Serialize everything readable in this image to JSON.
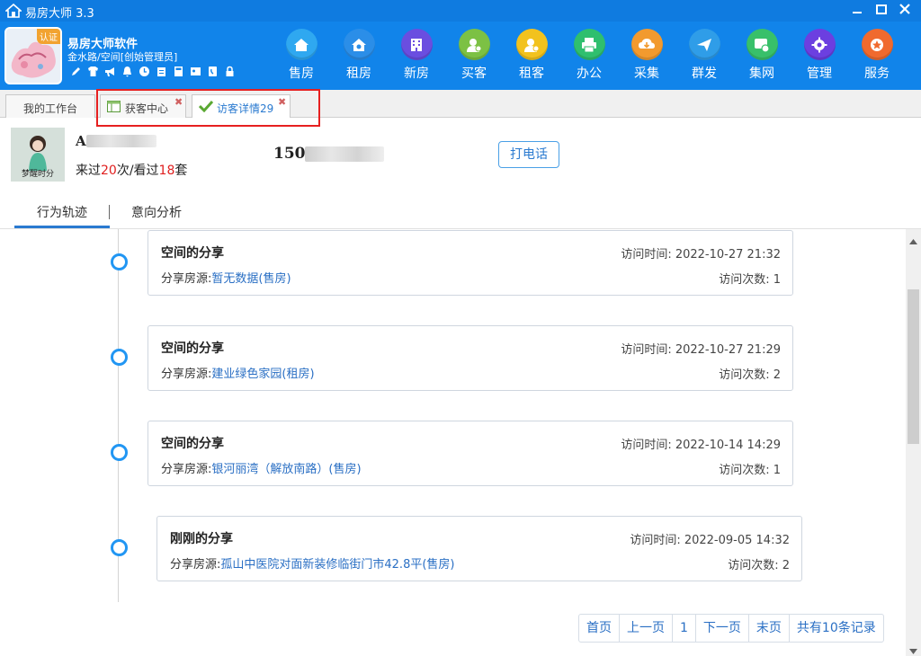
{
  "window": {
    "title": "易房大师 3.3"
  },
  "header": {
    "badge": "认证",
    "company": "易房大师软件",
    "subtitle": "金水路/空间[创始管理员]",
    "nav": [
      {
        "label": "售房",
        "icon": "home-icon",
        "color": "#2fa8f0"
      },
      {
        "label": "租房",
        "icon": "key-house-icon",
        "color": "#2b8ee8"
      },
      {
        "label": "新房",
        "icon": "building-icon",
        "color": "#6a4ee0"
      },
      {
        "label": "买客",
        "icon": "buyer-icon",
        "color": "#7cc144"
      },
      {
        "label": "租客",
        "icon": "renter-icon",
        "color": "#f2c21e"
      },
      {
        "label": "办公",
        "icon": "printer-icon",
        "color": "#2fbf6e"
      },
      {
        "label": "采集",
        "icon": "download-cloud-icon",
        "color": "#f29a2e"
      },
      {
        "label": "群发",
        "icon": "paper-plane-icon",
        "color": "#2f9de8"
      },
      {
        "label": "集网",
        "icon": "web-icon",
        "color": "#38c06a"
      },
      {
        "label": "管理",
        "icon": "gear-icon",
        "color": "#6c3fe0"
      },
      {
        "label": "服务",
        "icon": "service-icon",
        "color": "#f06a2e"
      }
    ]
  },
  "tabs": [
    {
      "label": "我的工作台"
    },
    {
      "label": "获客中心"
    },
    {
      "label": "访客详情29"
    }
  ],
  "visitor": {
    "name_initial": "A",
    "photo_caption": "梦醒时分",
    "stats_prefix": "来过",
    "visits": "20",
    "stats_mid": "次/看过",
    "viewed": "18",
    "stats_suffix": "套",
    "phone_prefix": "150",
    "call_button": "打电话"
  },
  "subtabs": {
    "behavior": "行为轨迹",
    "intent": "意向分析"
  },
  "records": [
    {
      "title": "空间的分享",
      "time_label": "访问时间:",
      "time": "2022-10-27 21:32",
      "source_label": "分享房源:",
      "source": "暂无数据(售房)",
      "count_label": "访问次数:",
      "count": "1"
    },
    {
      "title": "空间的分享",
      "time_label": "访问时间:",
      "time": "2022-10-27 21:29",
      "source_label": "分享房源:",
      "source": "建业绿色家园(租房)",
      "count_label": "访问次数:",
      "count": "2"
    },
    {
      "title": "空间的分享",
      "time_label": "访问时间:",
      "time": "2022-10-14 14:29",
      "source_label": "分享房源:",
      "source": "银河丽湾（解放南路）(售房)",
      "count_label": "访问次数:",
      "count": "1"
    },
    {
      "title": "刚刚的分享",
      "time_label": "访问时间:",
      "time": "2022-09-05 14:32",
      "source_label": "分享房源:",
      "source": "孤山中医院对面新装修临街门市42.8平(售房)",
      "count_label": "访问次数:",
      "count": "2"
    }
  ],
  "pagination": {
    "first": "首页",
    "prev": "上一页",
    "current": "1",
    "next": "下一页",
    "last": "末页",
    "total": "共有10条记录"
  }
}
